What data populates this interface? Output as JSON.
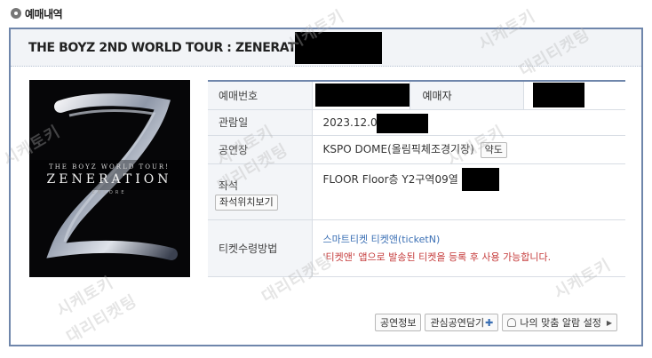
{
  "section": {
    "title": "예매내역",
    "icon": "gear-icon"
  },
  "event": {
    "title": "THE BOYZ 2ND WORLD TOUR : ZENERATION -"
  },
  "poster": {
    "top_text": "THE BOYZ WORLD TOUR!",
    "main_text": "ZENERATION",
    "sub_text": "ENCORE"
  },
  "info": {
    "reservation_no_label": "예매번호",
    "booker_label": "예매자",
    "date_label": "관람일",
    "date_value": "2023.12.0",
    "venue_label": "공연장",
    "venue_value": "KSPO DOME(올림픽체조경기장)",
    "map_button": "약도",
    "seat_label": "좌석",
    "seat_view_button": "좌석위치보기",
    "seat_value": "FLOOR Floor층 Y2구역09열",
    "ticket_method_label": "티켓수령방법",
    "ticket_method_link": "스마트티켓 티켓앤(ticketN)",
    "ticket_method_note": "'티켓앤' 앱으로 발송된 티켓을 등록 후 사용 가능합니다."
  },
  "actions": {
    "show_info": "공연정보",
    "add_interest": "관심공연담기",
    "alarm": "나의 맞춤 알람 설정"
  },
  "watermark": {
    "line1": "시케토키",
    "line2": "대리티켓팅"
  }
}
